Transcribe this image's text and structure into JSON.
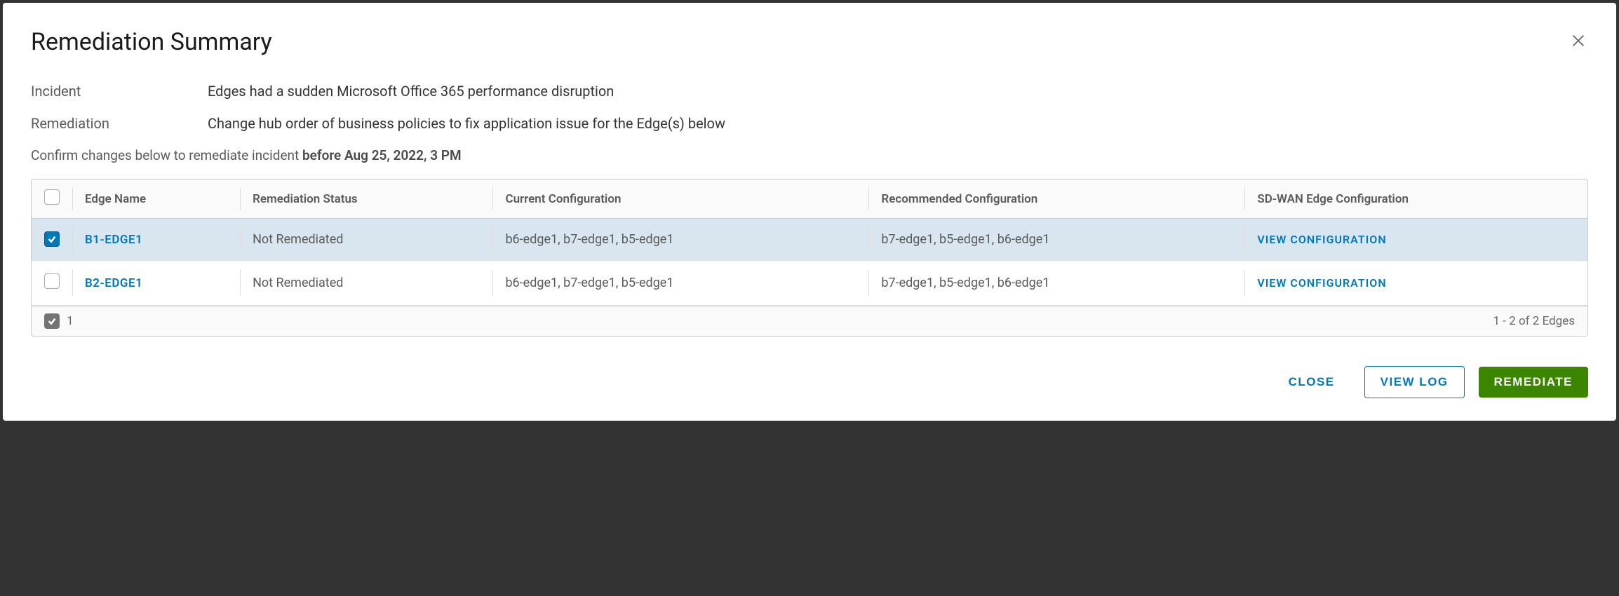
{
  "title": "Remediation Summary",
  "info": {
    "incident_label": "Incident",
    "incident_value": "Edges had a sudden Microsoft Office 365 performance disruption",
    "remediation_label": "Remediation",
    "remediation_value": "Change hub order of business policies to fix application issue for the Edge(s) below"
  },
  "confirm": {
    "prefix": "Confirm changes below to remediate incident ",
    "bold": "before Aug 25, 2022, 3 PM"
  },
  "table": {
    "headers": {
      "edge_name": "Edge Name",
      "remediation_status": "Remediation Status",
      "current_config": "Current Configuration",
      "recommended_config": "Recommended Configuration",
      "sdwan_config": "SD-WAN Edge Configuration"
    },
    "rows": [
      {
        "selected": true,
        "edge_name": "B1-EDGE1",
        "remediation_status": "Not Remediated",
        "current_config": "b6-edge1, b7-edge1, b5-edge1",
        "recommended_config": "b7-edge1, b5-edge1, b6-edge1",
        "action": "VIEW CONFIGURATION"
      },
      {
        "selected": false,
        "edge_name": "B2-EDGE1",
        "remediation_status": "Not Remediated",
        "current_config": "b6-edge1, b7-edge1, b5-edge1",
        "recommended_config": "b7-edge1, b5-edge1, b6-edge1",
        "action": "VIEW CONFIGURATION"
      }
    ],
    "footer": {
      "selected_count": "1",
      "pagination": "1 - 2 of 2 Edges"
    }
  },
  "actions": {
    "close": "CLOSE",
    "view_log": "VIEW LOG",
    "remediate": "REMEDIATE"
  }
}
